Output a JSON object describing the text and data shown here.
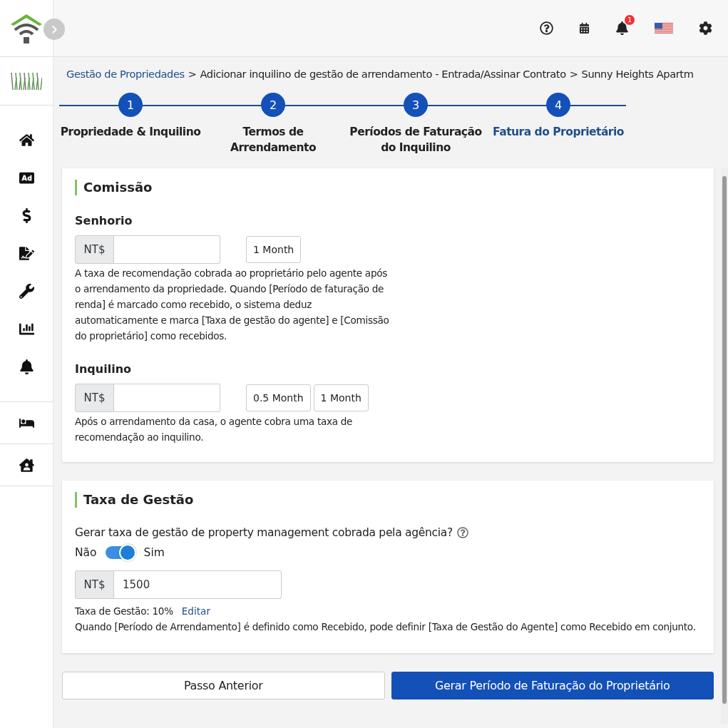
{
  "topbar": {
    "notification_count": "1"
  },
  "breadcrumb": {
    "separator": ">",
    "items": [
      {
        "label": "Gestão de Propriedades",
        "kind": "link"
      },
      {
        "label": "Adicionar inquilino de gestão de arrendamento - Entrada/Assinar Contrato",
        "kind": "text"
      },
      {
        "label": "Sunny Heights Apartm",
        "kind": "text"
      }
    ]
  },
  "steps": [
    {
      "number": "1",
      "label": "Propriedade & Inquilino",
      "selected": false
    },
    {
      "number": "2",
      "label": "Termos de Arrendamento",
      "selected": false
    },
    {
      "number": "3",
      "label": "Períodos de Faturação do Inquilino",
      "selected": false
    },
    {
      "number": "4",
      "label": "Fatura do Proprietário",
      "selected": true
    }
  ],
  "commission": {
    "title": "Comissão",
    "groups": [
      {
        "label": "Senhorio",
        "prefix": "NT$",
        "options": [
          "1 Month"
        ],
        "note": "A taxa de recomendação cobrada ao proprietário pelo agente após o arrendamento da propriedade. Quando [Período de faturação de renda] é marcado como recebido, o sistema deduz automaticamente e marca [Taxa de gestão do agente] e [Comissão do proprietário] como recebidos."
      },
      {
        "label": "Inquilino",
        "prefix": "NT$",
        "options": [
          "0.5 Month",
          "1 Month"
        ],
        "note": "Após o arrendamento da casa, o agente cobra uma taxa de recomendação ao inquilino."
      }
    ]
  },
  "management_fee": {
    "title": "Taxa de Gestão",
    "question": "Gerar taxa de gestão de property management cobrada pela agência?",
    "off_label": "Não",
    "on_label": "Sim",
    "on": true,
    "prefix": "NT$",
    "value": "1500",
    "rate": "Taxa de Gestão: 10%",
    "edit_link": "Editar",
    "note": "Quando [Período de Arrendamento] é definido como Recebido, pode definir [Taxa de Gestão do Agente] como Recebido em conjunto."
  },
  "buttons": [
    {
      "label": "Passo Anterior",
      "kind": "secondary"
    },
    {
      "label": "Gerar Período de Faturação do Proprietário",
      "kind": "primary"
    }
  ]
}
